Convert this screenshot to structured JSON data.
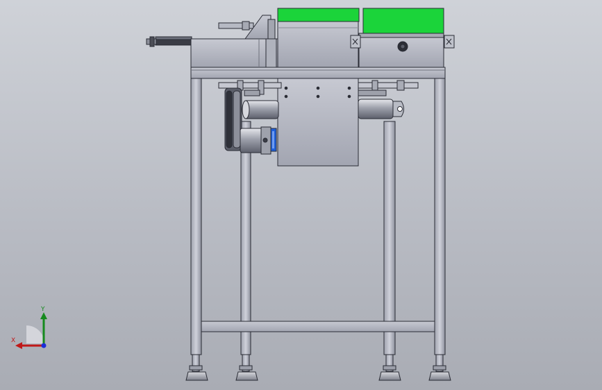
{
  "viewport": {
    "background_top": "#cfd2d8",
    "background_bottom": "#a9acb4"
  },
  "colors": {
    "steel": "#b9bcc8",
    "steel_dark": "#7c7f8c",
    "outline": "#2a2c35",
    "panel_green": "#1bd43a",
    "motor_blue": "#1f5fd8",
    "axis_x": "#c01818",
    "axis_y": "#168a1e",
    "axis_z": "#1c2ed8"
  },
  "triad": {
    "x_label": "X",
    "y_label": "Y"
  }
}
